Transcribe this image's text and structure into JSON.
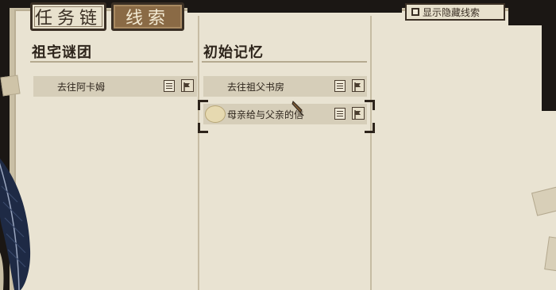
{
  "tabs": [
    {
      "label": "任务链",
      "active": false
    },
    {
      "label": "线索",
      "active": true
    }
  ],
  "show_hidden_clues": {
    "label": "显示隐藏线索",
    "checked": false
  },
  "columns": [
    {
      "title": "祖宅谜团",
      "clues": [
        {
          "text": "去往阿卡姆",
          "selected": false
        }
      ]
    },
    {
      "title": "初始记忆",
      "clues": [
        {
          "text": "去往祖父书房",
          "selected": false
        },
        {
          "text": "母亲给与父亲的信",
          "selected": true
        }
      ]
    }
  ],
  "icons": {
    "note": "document-icon",
    "flag": "flag-icon",
    "cursor": "quill-pen-cursor-icon",
    "decoration": "feather-quill-icon"
  },
  "colors": {
    "paper": "#e9e3d2",
    "clue_row": "#d6ceb9",
    "active_tab": "#8a6a45",
    "ink": "#2d241b",
    "background": "#1b1714"
  }
}
